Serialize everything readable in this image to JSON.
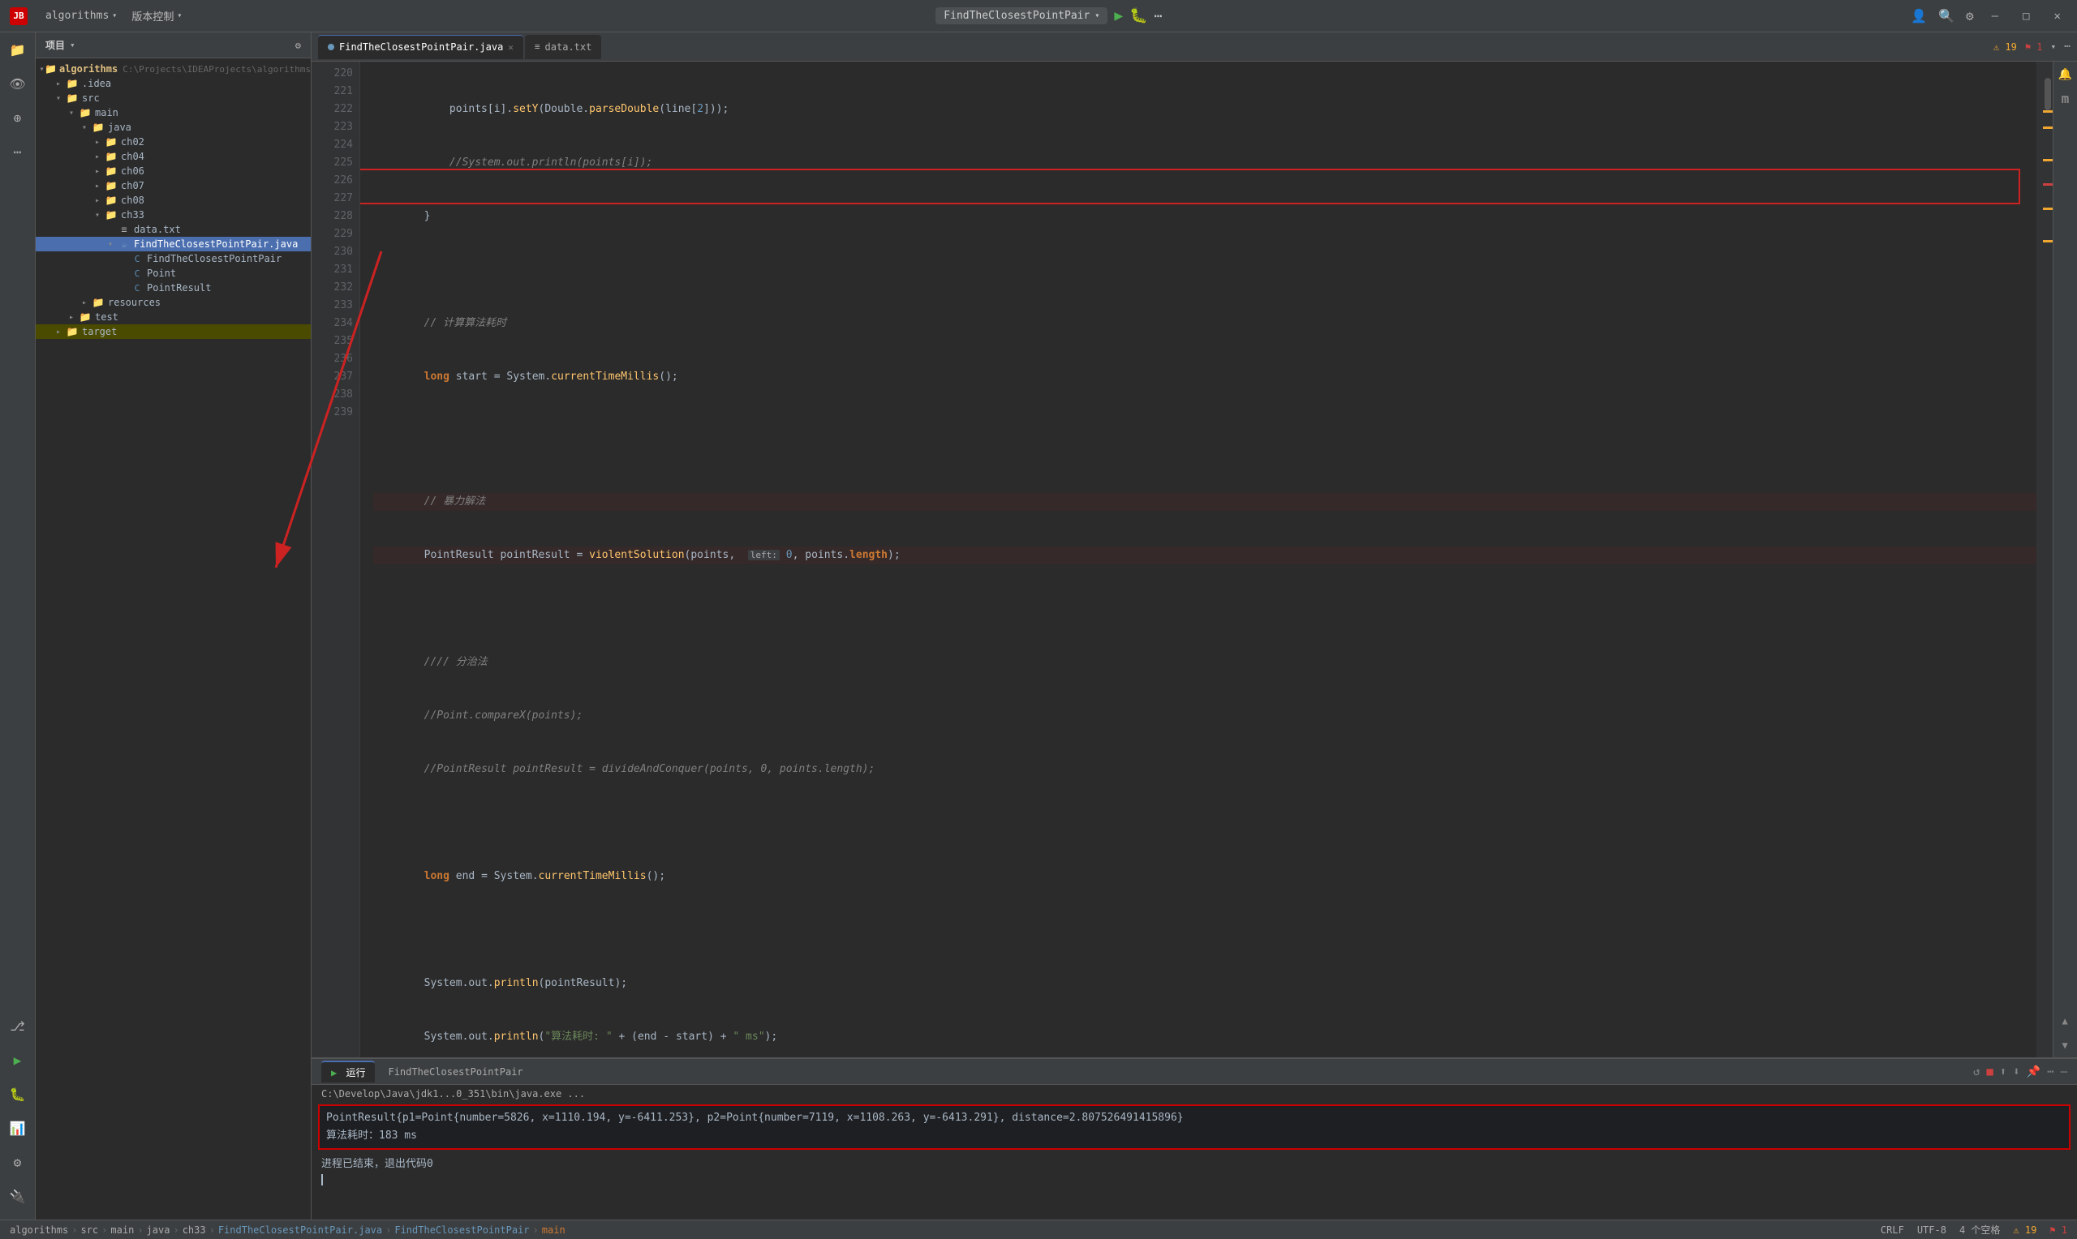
{
  "titlebar": {
    "logo": "JB",
    "menu_items": [
      "algorithms",
      "版本控制"
    ],
    "run_config": "FindTheClosestPointPair",
    "win_controls": [
      "–",
      "□",
      "✕"
    ]
  },
  "toolbar_icons": {
    "left": [
      "≡",
      "📁",
      "⊕",
      "..."
    ],
    "right_side": [
      "🔔",
      "m"
    ]
  },
  "sidebar": {
    "header_label": "项目",
    "root": {
      "name": "algorithms",
      "path": "C:\\Projects\\IDEAProjects\\algorithms",
      "children": [
        {
          "name": ".idea",
          "type": "folder",
          "indent": 1
        },
        {
          "name": "src",
          "type": "folder",
          "indent": 1,
          "expanded": true,
          "children": [
            {
              "name": "main",
              "type": "folder",
              "indent": 2,
              "expanded": true,
              "children": [
                {
                  "name": "java",
                  "type": "folder",
                  "indent": 3,
                  "expanded": true,
                  "children": [
                    {
                      "name": "ch02",
                      "type": "folder",
                      "indent": 4
                    },
                    {
                      "name": "ch04",
                      "type": "folder",
                      "indent": 4
                    },
                    {
                      "name": "ch06",
                      "type": "folder",
                      "indent": 4
                    },
                    {
                      "name": "ch07",
                      "type": "folder",
                      "indent": 4
                    },
                    {
                      "name": "ch08",
                      "type": "folder",
                      "indent": 4
                    },
                    {
                      "name": "ch33",
                      "type": "folder",
                      "indent": 4,
                      "expanded": true,
                      "children": [
                        {
                          "name": "data.txt",
                          "type": "file",
                          "indent": 5
                        },
                        {
                          "name": "FindTheClosestPointPair.java",
                          "type": "java",
                          "indent": 5,
                          "expanded": true,
                          "children": [
                            {
                              "name": "FindTheClosestPointPair",
                              "type": "class",
                              "indent": 6
                            },
                            {
                              "name": "Point",
                              "type": "class",
                              "indent": 6
                            },
                            {
                              "name": "PointResult",
                              "type": "class",
                              "indent": 6
                            }
                          ]
                        }
                      ]
                    }
                  ]
                },
                {
                  "name": "resources",
                  "type": "folder",
                  "indent": 3
                }
              ]
            }
          ]
        },
        {
          "name": "test",
          "type": "folder",
          "indent": 1
        },
        {
          "name": "target",
          "type": "folder",
          "indent": 1
        }
      ]
    }
  },
  "editor": {
    "tabs": [
      {
        "name": "FindTheClosestPointPair.java",
        "active": true,
        "type": "java"
      },
      {
        "name": "data.txt",
        "active": false,
        "type": "txt"
      }
    ],
    "lines": [
      {
        "num": 220,
        "code": "            points[i].setY(Double.parseDouble(line[2]));"
      },
      {
        "num": 221,
        "code": "            //System.out.println(points[i]);"
      },
      {
        "num": 222,
        "code": "        }"
      },
      {
        "num": 223,
        "code": ""
      },
      {
        "num": 224,
        "code": "        // 计算算法耗时"
      },
      {
        "num": 225,
        "code": "        long start = System.currentTimeMillis();"
      },
      {
        "num": 226,
        "code": ""
      },
      {
        "num": 227,
        "code": "        // 暴力解法"
      },
      {
        "num": 228,
        "code": "        PointResult pointResult = violentSolution(points,  left: 0, points.length);"
      },
      {
        "num": 229,
        "code": ""
      },
      {
        "num": 230,
        "code": "        //// 分治法"
      },
      {
        "num": 231,
        "code": "        //Point.compareX(points);"
      },
      {
        "num": 232,
        "code": "        //PointResult pointResult = divideAndConquer(points, 0, points.length);"
      },
      {
        "num": 233,
        "code": ""
      },
      {
        "num": 234,
        "code": "        long end = System.currentTimeMillis();"
      },
      {
        "num": 235,
        "code": ""
      },
      {
        "num": 236,
        "code": "        System.out.println(pointResult);"
      },
      {
        "num": 237,
        "code": "        System.out.println(\"算法耗时: \" + (end - start) + \" ms\");"
      },
      {
        "num": 238,
        "code": "    }"
      },
      {
        "num": 239,
        "code": ""
      }
    ]
  },
  "run_panel": {
    "tab_label": "运行",
    "config_label": "FindTheClosestPointPair",
    "java_path": "C:\\Develop\\Java\\jdk1...0_351\\bin\\java.exe ...",
    "output_line1": "PointResult{p1=Point{number=5826, x=1110.194, y=-6411.253}, p2=Point{number=7119, x=1108.263, y=-6413.291}, distance=2.807526491415896}",
    "output_line2": "算法耗时：183 ms",
    "process_done": "进程已结束，退出代码0"
  },
  "statusbar": {
    "breadcrumbs": [
      "algorithms",
      ">",
      "src",
      ">",
      "main",
      ">",
      "java",
      ">",
      "ch33",
      ">",
      "FindTheClosestPointPair.java",
      ">",
      "FindTheClosestPointPair",
      ">",
      "main"
    ],
    "crlf": "CRLF",
    "encoding": "UTF-8",
    "indent": "4 个空格",
    "warnings": "⚠ 19",
    "errors": "⚑ 1"
  },
  "icons": {
    "folder": "📁",
    "java_class": "☕",
    "file_txt": "📄",
    "run": "▶",
    "debug": "🐛",
    "stop": "■",
    "rerun": "↺",
    "settings": "⚙",
    "search": "🔍",
    "notifications": "🔔",
    "close": "✕",
    "minimize": "—",
    "maximize": "□",
    "chevron_down": "▾",
    "chevron_right": "▸"
  }
}
